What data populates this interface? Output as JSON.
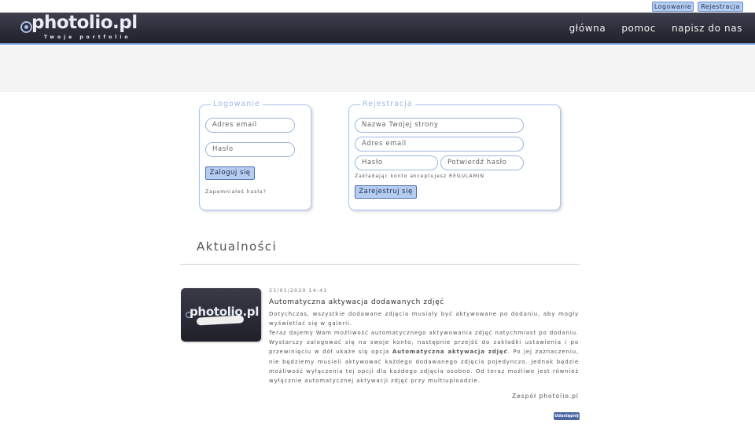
{
  "auth": {
    "login_label": "Logowanie",
    "register_label": "Rejestracja"
  },
  "brand": {
    "logo_text": "photolio.pl",
    "tagline": "Twoje portfolio"
  },
  "nav": [
    {
      "label": "główna"
    },
    {
      "label": "pomoc"
    },
    {
      "label": "napisz do nas"
    }
  ],
  "login": {
    "legend": "Logowanie",
    "email_placeholder": "Adres email",
    "password_placeholder": "Hasło",
    "submit_label": "Zaloguj się",
    "forgot_label": "Zapomniałeś hasła?"
  },
  "register": {
    "legend": "Rejestracja",
    "site_name_placeholder": "Nazwa Twojej strony",
    "email_placeholder": "Adres email",
    "password_placeholder": "Hasło",
    "confirm_placeholder": "Potwierdź hasło",
    "terms_text": "Zakładając konto akceptujesz REGULAMIN",
    "submit_label": "Zarejestruj się"
  },
  "news": {
    "heading": "Aktualności",
    "article": {
      "thumb_text": "photolio.pl",
      "date": "21/01/2020 14:41",
      "title": "Automatyczna aktywacja dodawanych zdjęć",
      "p1": "Dotychczas, wszystkie dodawane zdjęcia musiały być aktywowane po dodaniu, aby mogły wyświetlać się w galerii.",
      "p2_a": "Teraz dajemy Wam możliwość automatycznego aktywowania zdjęć natychmiast po dodaniu. Wystarczy zalogować się na swoje konto, następnie przejść do zakładki ustawienia i po przewinięciu w dół ukaże się opcja",
      "p2_bold": "Automatyczna aktywacja zdjęć",
      "p2_b": ". Po jej zaznaczeniu, nie będziemy musieli aktywować każdego dodawanego zdjęcia pojedynczo. Jednak będzie możliwość wyłączenia tej opcji dla każdego zdjęcia osobno. Od teraz możliwe jest również wyłącznie automatycznej aktywacji zdjęć przy multiuploadzie.",
      "signature": "Zespół photolio.pl",
      "share_label": "Udostępnij"
    }
  }
}
